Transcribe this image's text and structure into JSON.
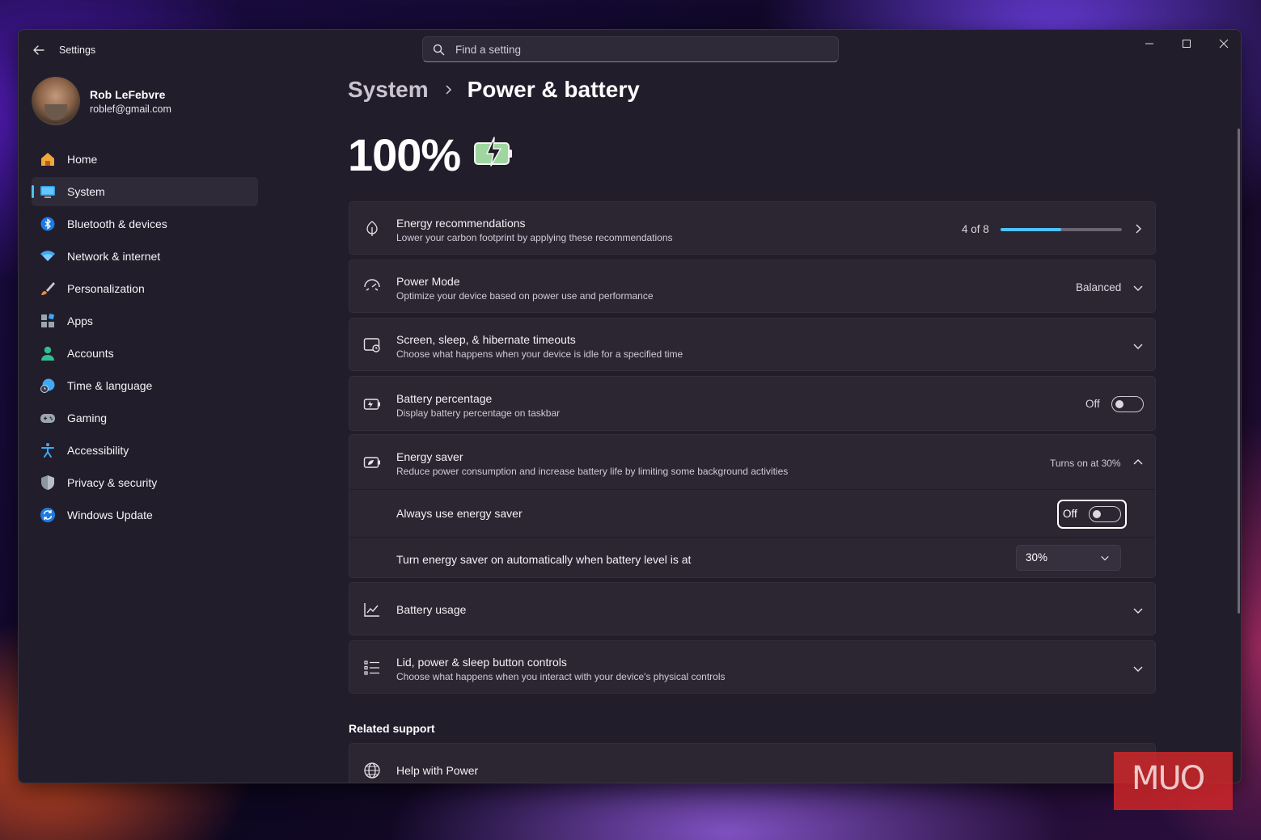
{
  "app": {
    "title": "Settings"
  },
  "search": {
    "placeholder": "Find a setting"
  },
  "profile": {
    "name": "Rob LeFebvre",
    "email": "roblef@gmail.com"
  },
  "sidebar": {
    "items": [
      {
        "label": "Home",
        "icon": "home-icon"
      },
      {
        "label": "System",
        "icon": "system-icon",
        "active": true
      },
      {
        "label": "Bluetooth & devices",
        "icon": "bluetooth-icon"
      },
      {
        "label": "Network & internet",
        "icon": "wifi-icon"
      },
      {
        "label": "Personalization",
        "icon": "brush-icon"
      },
      {
        "label": "Apps",
        "icon": "apps-icon"
      },
      {
        "label": "Accounts",
        "icon": "account-icon"
      },
      {
        "label": "Time & language",
        "icon": "globe-clock-icon"
      },
      {
        "label": "Gaming",
        "icon": "gamepad-icon"
      },
      {
        "label": "Accessibility",
        "icon": "accessibility-icon"
      },
      {
        "label": "Privacy & security",
        "icon": "shield-icon"
      },
      {
        "label": "Windows Update",
        "icon": "update-icon"
      }
    ]
  },
  "breadcrumb": {
    "parent": "System",
    "current": "Power & battery"
  },
  "battery": {
    "percent_label": "100%",
    "charging": true
  },
  "cards": {
    "energy_recommendations": {
      "title": "Energy recommendations",
      "sub": "Lower your carbon footprint by applying these recommendations",
      "count_label": "4 of 8",
      "progress": 0.5
    },
    "power_mode": {
      "title": "Power Mode",
      "sub": "Optimize your device based on power use and performance",
      "value": "Balanced"
    },
    "screen_sleep": {
      "title": "Screen, sleep, & hibernate timeouts",
      "sub": "Choose what happens when your device is idle for a specified time"
    },
    "battery_percentage": {
      "title": "Battery percentage",
      "sub": "Display battery percentage on taskbar",
      "state": "Off"
    },
    "energy_saver": {
      "title": "Energy saver",
      "sub": "Reduce power consumption and increase battery life by limiting some background activities",
      "status": "Turns on at 30%",
      "always_label": "Always use energy saver",
      "always_state": "Off",
      "auto_label": "Turn energy saver on automatically when battery level is at",
      "auto_value": "30%"
    },
    "battery_usage": {
      "title": "Battery usage"
    },
    "lid_controls": {
      "title": "Lid, power & sleep button controls",
      "sub": "Choose what happens when you interact with your device's physical controls"
    }
  },
  "related": {
    "heading": "Related support",
    "help_title": "Help with Power"
  },
  "watermark": {
    "text": "MUO"
  },
  "colors": {
    "accent": "#4cc2ff",
    "window_bg": "#221d2b",
    "card_bg": "#2b2632"
  }
}
